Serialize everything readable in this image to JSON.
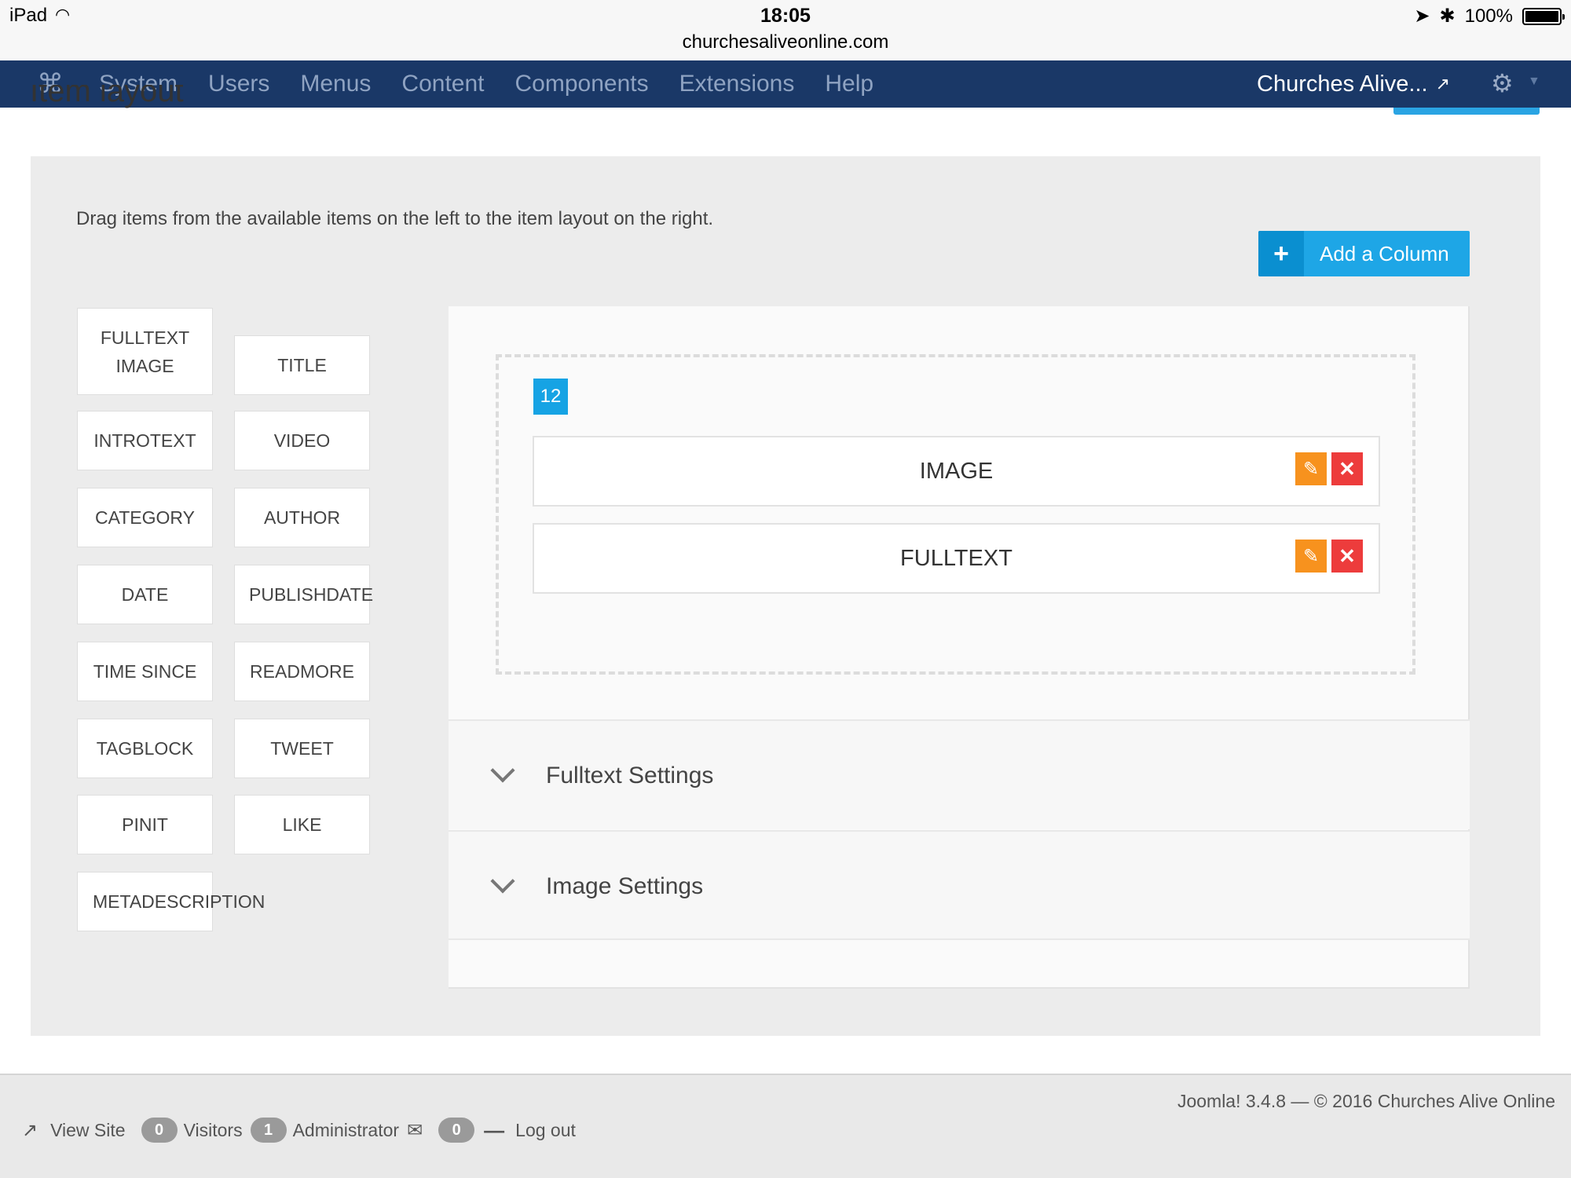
{
  "status_bar": {
    "device": "iPad",
    "time": "18:05",
    "url": "churchesaliveonline.com",
    "battery": "100%"
  },
  "navbar": {
    "menu": [
      "System",
      "Users",
      "Menus",
      "Content",
      "Components",
      "Extensions",
      "Help"
    ],
    "site_name": "Churches Alive...",
    "colors": {
      "background": "#1a3867",
      "menu_text": "#8fa3c2"
    }
  },
  "page": {
    "title": "Item layout"
  },
  "panel": {
    "instructions": "Drag items from the available items on the left to the item layout on the right.",
    "add_column_label": "Add a Column",
    "available_items": [
      {
        "label": "FULLTEXT IMAGE"
      },
      {
        "label": "TITLE"
      },
      {
        "label": "INTROTEXT"
      },
      {
        "label": "VIDEO"
      },
      {
        "label": "CATEGORY"
      },
      {
        "label": "AUTHOR"
      },
      {
        "label": "DATE"
      },
      {
        "label": "PUBLISHDATE"
      },
      {
        "label": "TIME SINCE"
      },
      {
        "label": "READMORE"
      },
      {
        "label": "TAGBLOCK"
      },
      {
        "label": "TWEET"
      },
      {
        "label": "PINIT"
      },
      {
        "label": "LIKE"
      },
      {
        "label": "METADESCRIPTION"
      }
    ],
    "layout": {
      "column_width": "12",
      "items": [
        "IMAGE",
        "FULLTEXT"
      ]
    },
    "accordions": [
      "Fulltext Settings",
      "Image Settings"
    ]
  },
  "footer": {
    "copyright": "Joomla! 3.4.8  —  © 2016 Churches Alive Online",
    "view_site": "View Site",
    "visitors_count": "0",
    "visitors_label": "Visitors",
    "admin_count": "1",
    "admin_label": "Administrator",
    "messages_count": "0",
    "logout": "Log out"
  }
}
